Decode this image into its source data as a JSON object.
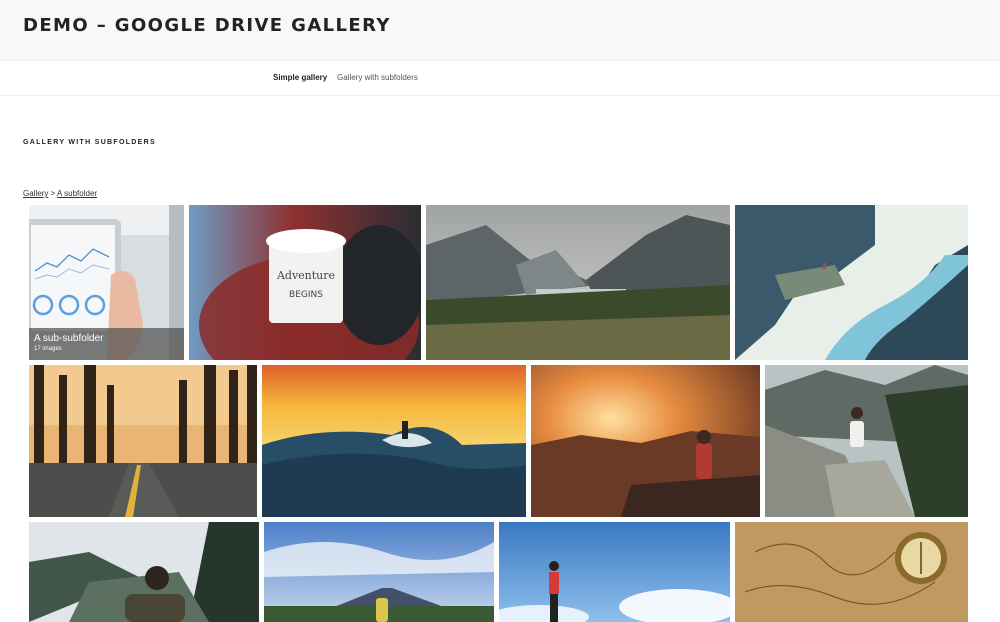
{
  "site": {
    "title": "DEMO – GOOGLE DRIVE GALLERY"
  },
  "nav": {
    "items": [
      {
        "label": "Simple gallery",
        "active": true
      },
      {
        "label": "Gallery with subfolders",
        "active": false
      }
    ]
  },
  "page": {
    "heading": "GALLERY WITH SUBFOLDERS"
  },
  "breadcrumb": {
    "root": "Gallery",
    "separator": " > ",
    "current": "A subfolder"
  },
  "subfolder": {
    "name": "A sub-subfolder",
    "count": "17 images"
  }
}
